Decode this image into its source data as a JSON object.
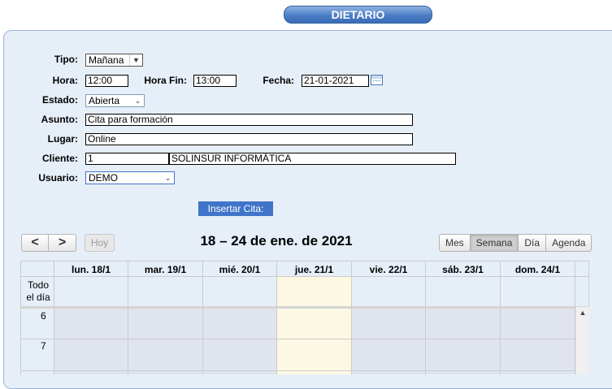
{
  "header": {
    "title": "DIETARIO"
  },
  "form": {
    "tipo": {
      "label": "Tipo:",
      "value": "Mañana"
    },
    "hora": {
      "label": "Hora:",
      "value": "12:00"
    },
    "hora_fin": {
      "label": "Hora Fin:",
      "value": "13:00"
    },
    "fecha": {
      "label": "Fecha:",
      "value": "21-01-2021"
    },
    "estado": {
      "label": "Estado:",
      "value": "Abierta"
    },
    "asunto": {
      "label": "Asunto:",
      "value": "Cita para formación"
    },
    "lugar": {
      "label": "Lugar:",
      "value": "Online"
    },
    "cliente": {
      "label": "Cliente:",
      "code": "1",
      "name": "SOLINSUR INFORMÁTICA"
    },
    "usuario": {
      "label": "Usuario:",
      "value": "DEMO"
    },
    "insert_button": "Insertar Cita:"
  },
  "calendar": {
    "prev": "<",
    "next": ">",
    "today": "Hoy",
    "title": "18 – 24 de ene. de 2021",
    "views": [
      "Mes",
      "Semana",
      "Día",
      "Agenda"
    ],
    "active_view": "Semana",
    "days": [
      "lun. 18/1",
      "mar. 19/1",
      "mié. 20/1",
      "jue. 21/1",
      "vie. 22/1",
      "sáb. 23/1",
      "dom. 24/1"
    ],
    "today_index": 3,
    "all_day_label": [
      "Todo",
      "el día"
    ],
    "hours": [
      "6",
      "7"
    ],
    "colors": {
      "today": "#fcf8e3",
      "slot": "#dfe4ee",
      "accent": "#3f74c8"
    }
  }
}
